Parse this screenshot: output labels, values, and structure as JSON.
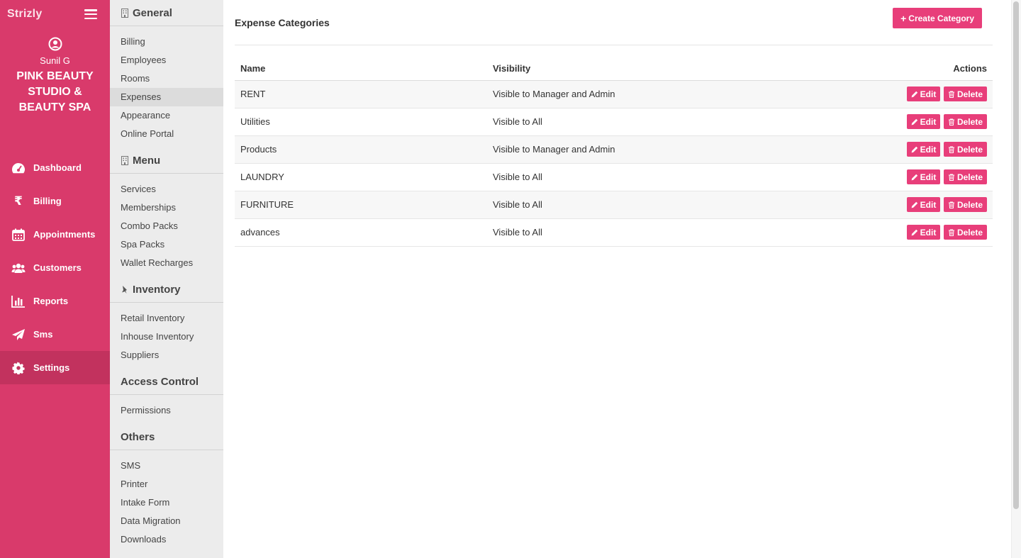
{
  "sidebar": {
    "brand": "Strizly",
    "user_name": "Sunil G",
    "studio_name": "PINK BEAUTY STUDIO & BEAUTY SPA",
    "nav": [
      {
        "label": "Dashboard",
        "icon": "dashboard-icon"
      },
      {
        "label": "Billing",
        "icon": "rupee-icon"
      },
      {
        "label": "Appointments",
        "icon": "calendar-icon"
      },
      {
        "label": "Customers",
        "icon": "users-icon"
      },
      {
        "label": "Reports",
        "icon": "bar-chart-icon"
      },
      {
        "label": "Sms",
        "icon": "paper-plane-icon"
      },
      {
        "label": "Settings",
        "icon": "gear-icon",
        "active": true
      }
    ]
  },
  "submenu": {
    "general": {
      "title": "General",
      "items": [
        "Billing",
        "Employees",
        "Rooms",
        "Expenses",
        "Appearance",
        "Online Portal"
      ]
    },
    "menu": {
      "title": "Menu",
      "items": [
        "Services",
        "Memberships",
        "Combo Packs",
        "Spa Packs",
        "Wallet Recharges"
      ]
    },
    "inventory": {
      "title": "Inventory",
      "items": [
        "Retail Inventory",
        "Inhouse Inventory",
        "Suppliers"
      ]
    },
    "access": {
      "title": "Access Control",
      "items": [
        "Permissions"
      ]
    },
    "others": {
      "title": "Others",
      "items": [
        "SMS",
        "Printer",
        "Intake Form",
        "Data Migration",
        "Downloads"
      ]
    },
    "active_item": "Expenses"
  },
  "main": {
    "title": "Expense Categories",
    "create_label": "Create Category",
    "table": {
      "columns": [
        "Name",
        "Visibility",
        "Actions"
      ],
      "rows": [
        {
          "name": "RENT",
          "visibility": "Visible to Manager and Admin"
        },
        {
          "name": "Utilities",
          "visibility": "Visible to All"
        },
        {
          "name": "Products",
          "visibility": "Visible to Manager and Admin"
        },
        {
          "name": "LAUNDRY",
          "visibility": "Visible to All"
        },
        {
          "name": "FURNITURE",
          "visibility": "Visible to All"
        },
        {
          "name": "advances",
          "visibility": "Visible to All"
        }
      ],
      "edit_label": "Edit",
      "delete_label": "Delete"
    }
  },
  "colors": {
    "sidebar": "#d93a6b",
    "accent": "#e83e7a",
    "submenu_bg": "#ececec"
  }
}
